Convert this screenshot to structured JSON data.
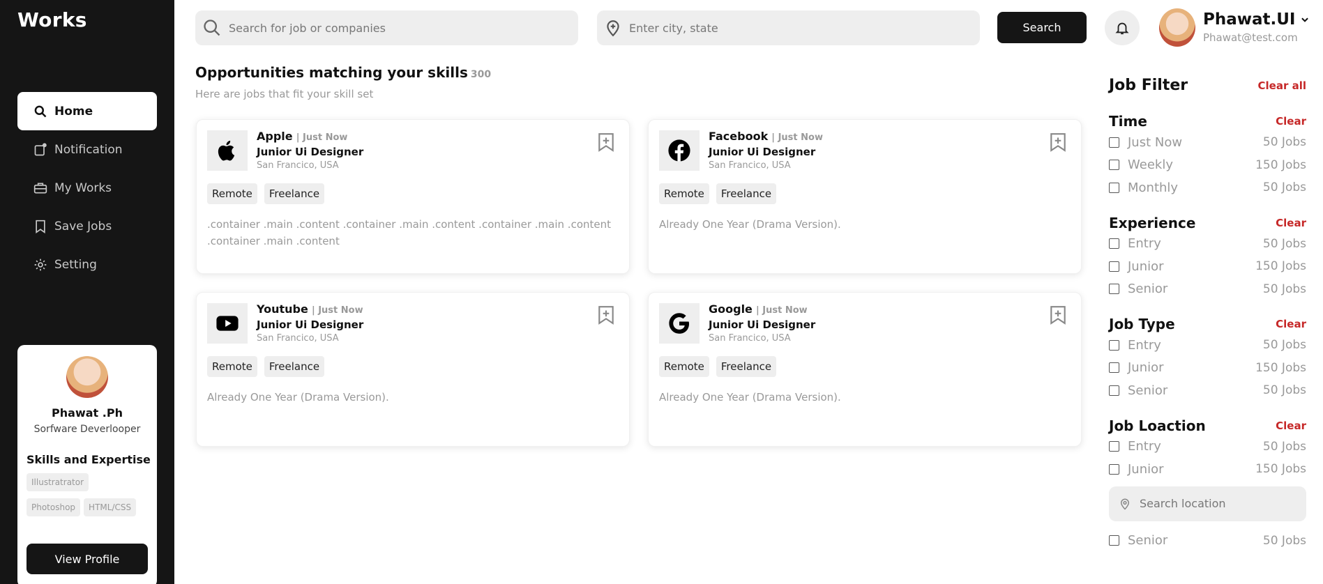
{
  "brand": "Works",
  "nav": [
    {
      "label": "Home",
      "icon": "search-icon",
      "active": true
    },
    {
      "label": "Notification",
      "icon": "notification-icon"
    },
    {
      "label": "My Works",
      "icon": "briefcase-icon"
    },
    {
      "label": "Save Jobs",
      "icon": "bookmark-icon"
    },
    {
      "label": "Setting",
      "icon": "gear-icon"
    }
  ],
  "profile": {
    "name": "Phawat .Ph",
    "role": "Sorfware Deverlooper",
    "skills_title": "Skills and Expertise",
    "skills": [
      "Illustratrator",
      "Photoshop",
      "HTML/CSS"
    ],
    "view_profile": "View Profile"
  },
  "search": {
    "job_placeholder": "Search for job or companies",
    "location_placeholder": "Enter city, state",
    "button": "Search"
  },
  "user": {
    "name": "Phawat.UI",
    "email": "Phawat@test.com"
  },
  "main": {
    "heading": "Opportunities matching your skills",
    "count": "300",
    "subheading": "Here are jobs that fit your skill set"
  },
  "jobs": [
    {
      "company": "Apple",
      "time": "| Just Now",
      "title": "Junior Ui Designer",
      "location": "San Francico, USA",
      "tags": [
        "Remote",
        "Freelance"
      ],
      "description": ".container .main .content .container .main .content .container .main .content .container .main .content",
      "logo": "apple-logo-icon"
    },
    {
      "company": "Facebook",
      "time": "| Just Now",
      "title": "Junior Ui Designer",
      "location": "San Francico, USA",
      "tags": [
        "Remote",
        "Freelance"
      ],
      "description": "Already One Year (Drama Version).",
      "logo": "facebook-logo-icon"
    },
    {
      "company": "Youtube",
      "time": "| Just Now",
      "title": "Junior Ui Designer",
      "location": "San Francico, USA",
      "tags": [
        "Remote",
        "Freelance"
      ],
      "description": "Already One Year (Drama Version).",
      "logo": "youtube-logo-icon"
    },
    {
      "company": "Google",
      "time": "| Just Now",
      "title": "Junior Ui Designer",
      "location": "San Francico, USA",
      "tags": [
        "Remote",
        "Freelance"
      ],
      "description": "Already One Year (Drama Version).",
      "logo": "google-logo-icon"
    }
  ],
  "filter": {
    "title": "Job Filter",
    "clear_all": "Clear all",
    "clear": "Clear",
    "groups": [
      {
        "title": "Time",
        "options": [
          {
            "label": "Just Now",
            "count": "50 Jobs"
          },
          {
            "label": "Weekly",
            "count": "150 Jobs"
          },
          {
            "label": "Monthly",
            "count": "50 Jobs"
          }
        ]
      },
      {
        "title": "Experience",
        "options": [
          {
            "label": "Entry",
            "count": "50 Jobs"
          },
          {
            "label": "Junior",
            "count": "150 Jobs"
          },
          {
            "label": "Senior",
            "count": "50 Jobs"
          }
        ]
      },
      {
        "title": "Job Type",
        "options": [
          {
            "label": "Entry",
            "count": "50 Jobs"
          },
          {
            "label": "Junior",
            "count": "150 Jobs"
          },
          {
            "label": "Senior",
            "count": "50 Jobs"
          }
        ]
      },
      {
        "title": "Job Loaction",
        "options": [
          {
            "label": "Entry",
            "count": "50 Jobs"
          },
          {
            "label": "Junior",
            "count": "150 Jobs"
          }
        ]
      }
    ],
    "location_placeholder": "Search location",
    "cut_option": {
      "label": "Senior",
      "count": "50 Jobs"
    }
  },
  "colors": {
    "dark": "#151515",
    "accent_red": "#c62828",
    "light_gray": "#eeeeee"
  }
}
